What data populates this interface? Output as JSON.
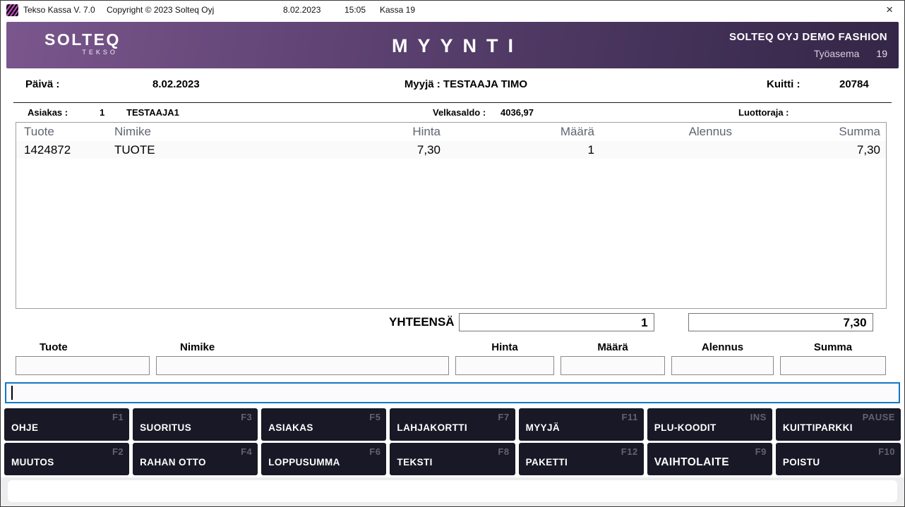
{
  "titlebar": {
    "app_title": "Tekso Kassa V. 7.0",
    "copyright": "Copyright © 2023 Solteq Oyj",
    "date": "8.02.2023",
    "time": "15:05",
    "register": "Kassa 19",
    "close_glyph": "×"
  },
  "brand": {
    "logo_main": "SOLTEQ",
    "logo_sub": "TEKSO",
    "screen_title": "MYYNTI",
    "store_name": "SOLTEQ OYJ DEMO FASHION",
    "workstation_label": "Työasema",
    "workstation_number": "19"
  },
  "info": {
    "date_label": "Päivä :",
    "date_value": "8.02.2023",
    "seller_line": "Myyjä : TESTAAJA TIMO",
    "receipt_label": "Kuitti :",
    "receipt_value": "20784"
  },
  "customer": {
    "label": "Asiakas :",
    "number": "1",
    "name": "TESTAAJA1",
    "debt_label": "Velkasaldo :",
    "debt_value": "4036,97",
    "credit_label": "Luottoraja :",
    "credit_value": ""
  },
  "sale_table": {
    "columns": [
      "Tuote",
      "Nimike",
      "Hinta",
      "Määrä",
      "Alennus",
      "Summa"
    ],
    "rows": [
      [
        "1424872",
        "TUOTE",
        "7,30",
        "1",
        "",
        "7,30"
      ]
    ]
  },
  "totals": {
    "label": "YHTEENSÄ",
    "quantity": "1",
    "amount": "7,30"
  },
  "entry": {
    "fields": [
      {
        "label": "Tuote",
        "value": ""
      },
      {
        "label": "Nimike",
        "value": ""
      },
      {
        "label": "Hinta",
        "value": ""
      },
      {
        "label": "Määrä",
        "value": ""
      },
      {
        "label": "Alennus",
        "value": ""
      },
      {
        "label": "Summa",
        "value": ""
      }
    ]
  },
  "command_line": {
    "value": ""
  },
  "function_keys": [
    [
      {
        "label": "OHJE",
        "key": "F1"
      },
      {
        "label": "SUORITUS",
        "key": "F3"
      },
      {
        "label": "ASIAKAS",
        "key": "F5"
      },
      {
        "label": "LAHJAKORTTI",
        "key": "F7"
      },
      {
        "label": "MYYJÄ",
        "key": "F11"
      },
      {
        "label": "PLU-KOODIT",
        "key": "INS"
      },
      {
        "label": "KUITTIPARKKI",
        "key": "PAUSE"
      }
    ],
    [
      {
        "label": "MUUTOS",
        "key": "F2"
      },
      {
        "label": "RAHAN OTTO",
        "key": "F4"
      },
      {
        "label": "LOPPUSUMMA",
        "key": "F6"
      },
      {
        "label": "TEKSTI",
        "key": "F8"
      },
      {
        "label": "PAKETTI",
        "key": "F12"
      },
      {
        "label": "VAIHTOLAITE",
        "key": "F9"
      },
      {
        "label": "POISTU",
        "key": "F10"
      }
    ]
  ],
  "colors": {
    "header_purple_light": "#7a568c",
    "header_purple_dark": "#342647",
    "button_bg": "#181826",
    "focus_blue": "#1379c4"
  }
}
